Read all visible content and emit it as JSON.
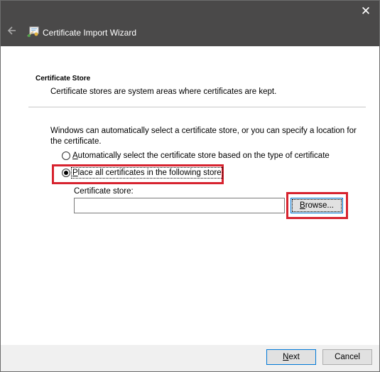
{
  "window": {
    "title": "Certificate Import Wizard"
  },
  "section": {
    "title": "Certificate Store",
    "description": "Certificate stores are system areas where certificates are kept."
  },
  "instruction": "Windows can automatically select a certificate store, or you can specify a location for the certificate.",
  "options": {
    "auto": {
      "first": "A",
      "rest": "utomatically select the certificate store based on the type of certificate",
      "selected": false
    },
    "manual": {
      "first": "P",
      "rest": "lace all certificates in the following store",
      "selected": true
    }
  },
  "store": {
    "label": "Certificate store:",
    "value": ""
  },
  "buttons": {
    "browse": {
      "first": "B",
      "rest": "rowse..."
    },
    "next": {
      "first": "N",
      "rest": "ext"
    },
    "cancel": "Cancel"
  },
  "colors": {
    "titlebar": "#4a4949",
    "highlight": "#d7232f",
    "focus": "#0078d7"
  },
  "icons": {
    "close": "close-icon",
    "back": "back-arrow-icon",
    "wizard": "certificate-wizard-icon"
  }
}
